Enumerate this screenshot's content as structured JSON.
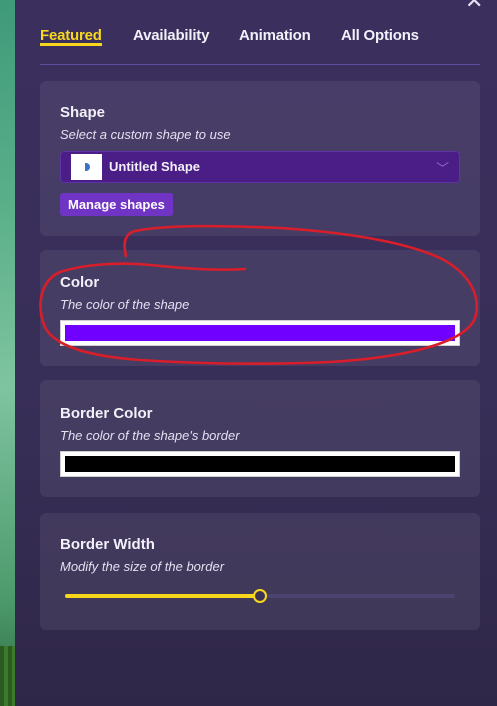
{
  "tabs": [
    {
      "label": "Featured",
      "active": true
    },
    {
      "label": "Availability",
      "active": false
    },
    {
      "label": "Animation",
      "active": false
    },
    {
      "label": "All Options",
      "active": false
    }
  ],
  "shape": {
    "title": "Shape",
    "description": "Select a custom shape to use",
    "selected": "Untitled Shape",
    "manage_label": "Manage shapes"
  },
  "color": {
    "title": "Color",
    "description": "The color of the shape",
    "value": "#7000ff"
  },
  "border_color": {
    "title": "Border Color",
    "description": "The color of the shape's border",
    "value": "#000000"
  },
  "border_width": {
    "title": "Border Width",
    "description": "Modify the size of the border",
    "fraction": 0.5
  },
  "colors": {
    "accent": "#f8d81c",
    "panel": "#3b2f5e",
    "select": "#4a1e86",
    "button": "#7034c4",
    "annotation": "#d81e2a"
  },
  "icons": {
    "close": "close-icon",
    "chevron": "chevron-down-icon"
  }
}
